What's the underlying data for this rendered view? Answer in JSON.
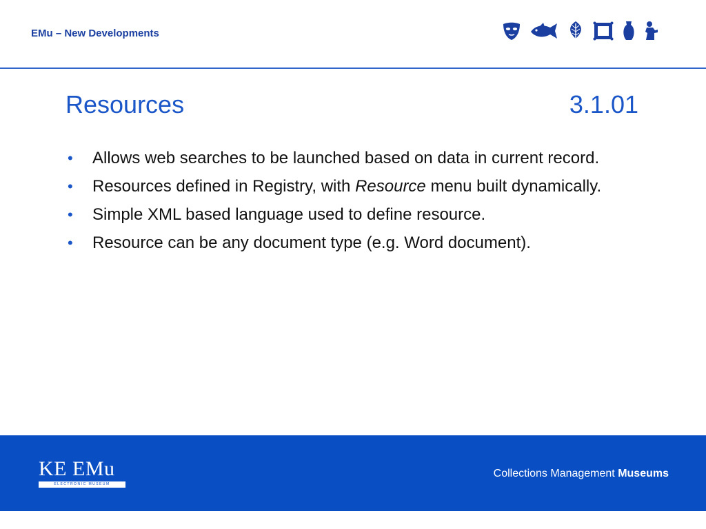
{
  "header": {
    "title": "EMu – New Developments",
    "icons": [
      "mask-icon",
      "fish-icon",
      "leaf-icon",
      "frame-icon",
      "vase-icon",
      "statue-icon"
    ],
    "accent_color": "#1a3fa0"
  },
  "slide": {
    "title": "Resources",
    "number": "3.1.01",
    "title_color": "#1a56c8",
    "bullets": [
      {
        "text": "Allows web searches to be launched based on data in current record."
      },
      {
        "pre": "Resources defined in Registry, with ",
        "italic": "Resource",
        "post": " menu built dynamically."
      },
      {
        "text": "Simple XML based language used to define resource."
      },
      {
        "text": "Resource can be any document type (e.g. Word document)."
      }
    ]
  },
  "footer": {
    "logo_text": "KE EMu",
    "logo_subtext": "ELECTRONIC MUSEUM",
    "tagline_regular": "Collections Management ",
    "tagline_bold": "Museums",
    "background_color": "#0a4ec4"
  }
}
